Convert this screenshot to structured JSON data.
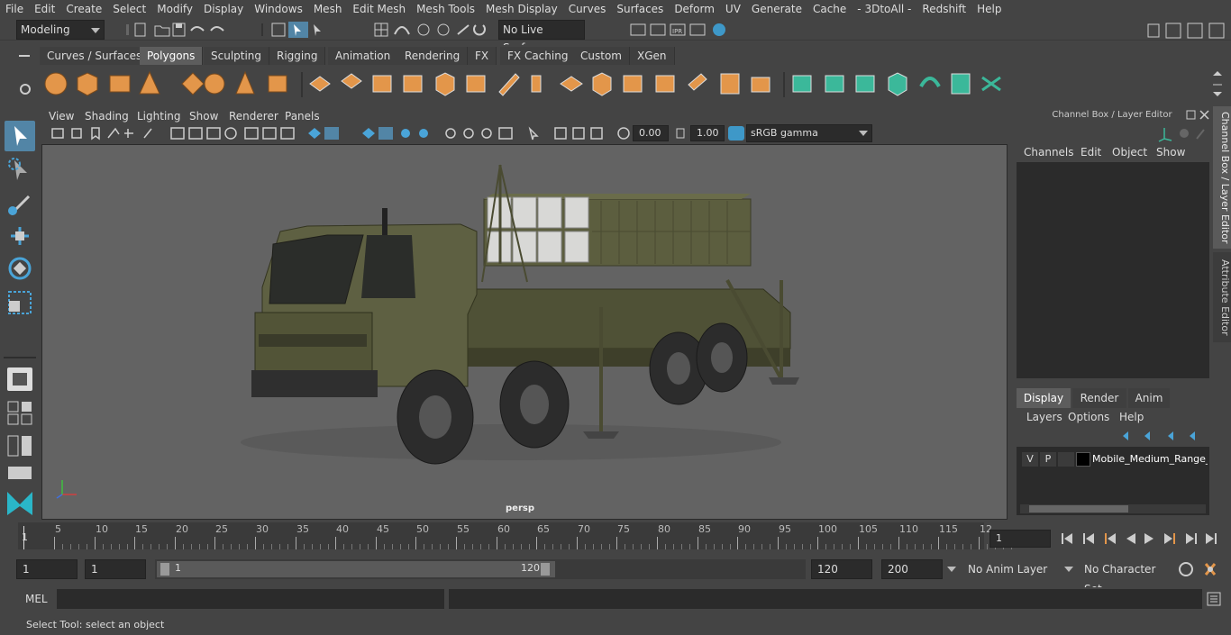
{
  "menubar": {
    "items": [
      "File",
      "Edit",
      "Create",
      "Select",
      "Modify",
      "Display",
      "Windows",
      "Mesh",
      "Edit Mesh",
      "Mesh Tools",
      "Mesh Display",
      "Curves",
      "Surfaces",
      "Deform",
      "UV",
      "Generate",
      "Cache",
      "- 3DtoAll -",
      "Redshift",
      "Help"
    ]
  },
  "status_line": {
    "mode": "Modeling",
    "live_surface": "No Live Surface"
  },
  "shelf": {
    "tabs": [
      "Curves / Surfaces",
      "Polygons",
      "Sculpting",
      "Rigging",
      "Animation",
      "Rendering",
      "FX",
      "FX Caching",
      "Custom",
      "XGen"
    ],
    "active_tab": "Polygons"
  },
  "viewport": {
    "menu": [
      "View",
      "Shading",
      "Lighting",
      "Show",
      "Renderer",
      "Panels"
    ],
    "exposure": "0.00",
    "gamma": "1.00",
    "color_space": "sRGB gamma",
    "camera_label": "persp"
  },
  "channel_box": {
    "title": "Channel Box / Layer Editor",
    "menu": [
      "Channels",
      "Edit",
      "Object",
      "Show"
    ],
    "layer_tabs": [
      "Display",
      "Render",
      "Anim"
    ],
    "active_layer_tab": "Display",
    "layer_menu": [
      "Layers",
      "Options",
      "Help"
    ],
    "layer": {
      "v": "V",
      "p": "P",
      "name": "Mobile_Medium_Range_"
    }
  },
  "side_tabs": [
    "Channel Box / Layer Editor",
    "Attribute Editor"
  ],
  "timeline": {
    "ticks": [
      "5",
      "10",
      "15",
      "20",
      "25",
      "30",
      "35",
      "40",
      "45",
      "50",
      "55",
      "60",
      "65",
      "70",
      "75",
      "80",
      "85",
      "90",
      "95",
      "100",
      "105",
      "110",
      "115",
      "12"
    ],
    "start_marker": "1",
    "current_frame": "1"
  },
  "range": {
    "start": "1",
    "playback_start": "1",
    "slider_start": "1",
    "slider_end": "120",
    "playback_end": "120",
    "end": "200",
    "anim_layer": "No Anim Layer",
    "character_set": "No Character Set"
  },
  "mel": {
    "label": "MEL"
  },
  "status": {
    "text": "Select Tool: select an object"
  },
  "colors": {
    "accent": "#5285a6",
    "shelf_orange": "#e3964a",
    "shelf_green": "#3bb89a",
    "truck": "#5a5a3e"
  }
}
